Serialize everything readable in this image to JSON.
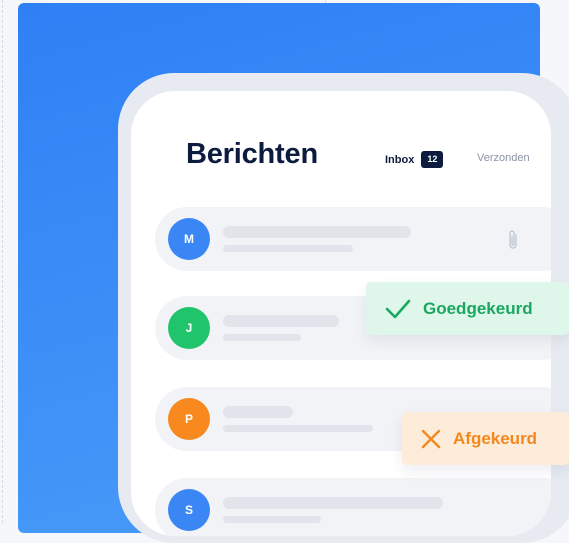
{
  "header": {
    "title": "Berichten",
    "tabs": [
      {
        "label": "Inbox",
        "badge": "12"
      },
      {
        "label": "Verzonden"
      }
    ]
  },
  "messages": [
    {
      "initial": "M",
      "color": "#3b86f5",
      "attachment_icon": "paperclip-icon"
    },
    {
      "initial": "J",
      "color": "#1fc46b"
    },
    {
      "initial": "P",
      "color": "#f7891f"
    },
    {
      "initial": "S",
      "color": "#3b86f5"
    }
  ],
  "notifications": {
    "approved": {
      "label": "Goedgekeurd",
      "icon": "check-icon",
      "color": "#1aa860"
    },
    "rejected": {
      "label": "Afgekeurd",
      "icon": "close-icon",
      "color": "#f2881f"
    }
  }
}
